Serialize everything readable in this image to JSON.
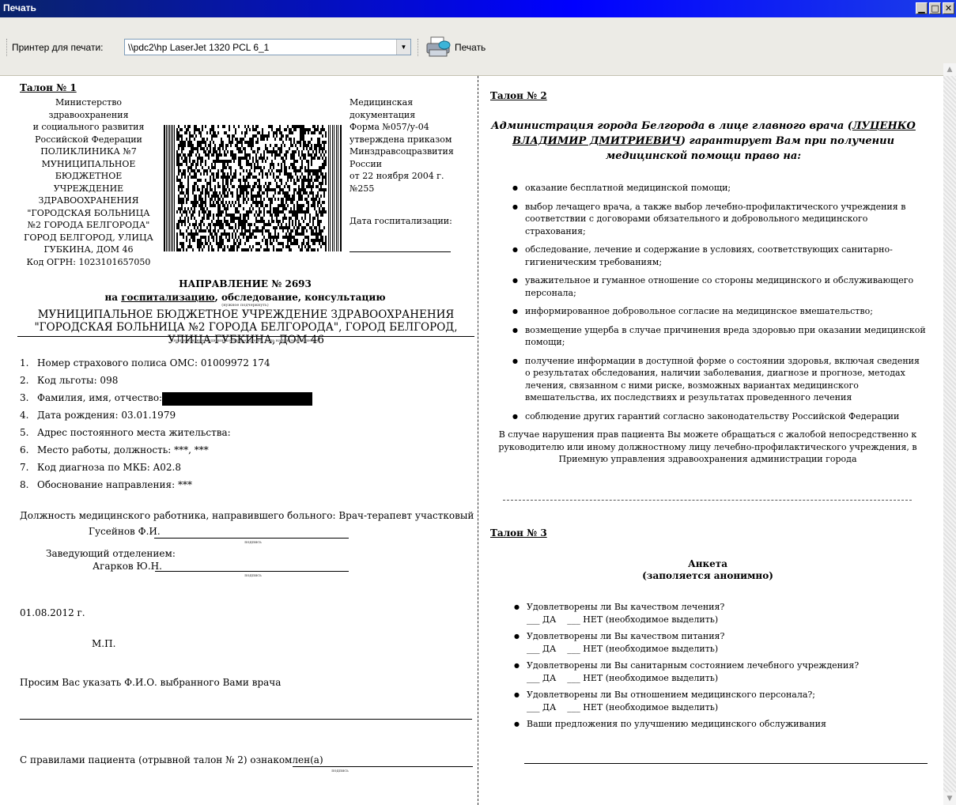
{
  "window": {
    "title": "Печать"
  },
  "toolbar": {
    "printer_label": "Принтер для печати:",
    "printer_value": "\\\\pdc2\\hp LaserJet 1320 PCL 6_1",
    "print_label": "Печать"
  },
  "talon1": {
    "heading": "Талон № 1",
    "org": [
      "Министерство",
      "здравоохранения",
      "и социального развития",
      "Российской Федерации",
      "ПОЛИКЛИНИКА №7",
      "МУНИЦИПАЛЬНОЕ",
      "БЮДЖЕТНОЕ",
      "УЧРЕЖДЕНИЕ",
      "ЗДРАВООХРАНЕНИЯ",
      "\"ГОРОДСКАЯ БОЛЬНИЦА",
      "№2 ГОРОДА БЕЛГОРОДА\"",
      "ГОРОД БЕЛГОРОД, УЛИЦА",
      "ГУБКИНА, ДОМ 46",
      "Код ОГРН: 1023101657050"
    ],
    "med_doc": [
      "Медицинская",
      "документация",
      "Форма №057/у-04",
      "утверждена приказом",
      "Минздравсоцразвития",
      "России",
      "от 22 ноября 2004 г.",
      "№255"
    ],
    "hosp_date_label": "Дата госпитализации:",
    "direction_title": "НАПРАВЛЕНИЕ № 2693",
    "direction_sub_pre": "на ",
    "direction_sub_underlined": "госпитализацию",
    "direction_sub_post": ", обследование, консультацию",
    "underline_note": "(нужное подчеркнуть)",
    "institution": "МУНИЦИПАЛЬНОЕ БЮДЖЕТНОЕ УЧРЕЖДЕНИЕ ЗДРАВООХРАНЕНИЯ \"ГОРОДСКАЯ БОЛЬНИЦА №2 ГОРОДА БЕЛГОРОДА\", ГОРОД БЕЛГОРОД, УЛИЦА ГУБКИНА, ДОМ 46",
    "institution_note": "(наименование медицинского учреждения, куда направлен пациент)",
    "items": [
      {
        "num": "1.",
        "text": "Номер страхового полиса ОМС: 01009972 174"
      },
      {
        "num": "2.",
        "text": "Код льготы: 098"
      },
      {
        "num": "3.",
        "text": "Фамилия, имя, отчество:"
      },
      {
        "num": "4.",
        "text": "Дата рождения: 03.01.1979"
      },
      {
        "num": "5.",
        "text": "Адрес постоянного места жительства:"
      },
      {
        "num": "6.",
        "text": "Место работы, должность: ***, ***"
      },
      {
        "num": "7.",
        "text": "Код диагноза по МКБ: A02.8"
      },
      {
        "num": "8.",
        "text": "Обоснование направления: ***"
      }
    ],
    "position_text": "Должность медицинского работника, направившего больного: Врач-терапевт участковый",
    "doctor_name": "Гусейнов Ф.И.",
    "signature_note": "подпись",
    "head_label": "Заведующий отделением:",
    "head_name": "Агарков Ю.Н.",
    "date": "01.08.2012 г.",
    "stamp": "М.П.",
    "choose_doctor": "Просим Вас указать Ф.И.О. выбранного Вами врача",
    "rules_ack": "С правилами пациента (отрывной талон № 2) ознакомлен(а)"
  },
  "talon2": {
    "heading": "Талон № 2",
    "intro_pre": "Администрация города Белгорода в лице главного врача (",
    "intro_name": "ЛУЦЕНКО ВЛАДИМИР ДМИТРИЕВИЧ",
    "intro_post": ") гарантирует Вам при получении медицинской помощи право на:",
    "rights": [
      "оказание бесплатной медицинской помощи;",
      "выбор лечащего врача, а также выбор лечебно-профилактического учреждения в соответствии с договорами обязательного и добровольного медицинского страхования;",
      "обследование, лечение и содержание в условиях, соответствующих санитарно-гигиеническим требованиям;",
      "уважительное и гуманное отношение со стороны медицинского и обслуживающего персонала;",
      "информированное добровольное согласие на медицинское вмешательство;",
      "возмещение ущерба в случае причинения вреда здоровью при оказании медицинской помощи;",
      "получение информации в доступной форме о состоянии здоровья, включая сведения о результатах обследования, наличии заболевания, диагнозе и прогнозе, методах лечения, связанном с ними риске, возможных вариантах медицинского вмешательства, их последствиях и результатах проведенного лечения",
      "соблюдение других гарантий согласно законодательству Российской Федерации"
    ],
    "complaint": "В случае нарушения прав пациента Вы можете обращаться с жалобой непосредственно к руководителю или иному должностному лицу лечебно-профилактического учреждения, в Приемную управления здравоохранения администрации города"
  },
  "talon3": {
    "heading": "Талон № 3",
    "title": "Анкета",
    "subtitle": "(заполяется анонимно)",
    "questions": [
      {
        "q": "Удовлетворены ли Вы качеством лечения?",
        "a": "___ ДА    ___ НЕТ (необходимое выделить)"
      },
      {
        "q": "Удовлетворены ли Вы качеством питания?",
        "a": "___ ДА    ___ НЕТ (необходимое выделить)"
      },
      {
        "q": "Удовлетворены ли Вы санитарным состоянием лечебного учреждения?",
        "a": "___ ДА    ___ НЕТ (необходимое выделить)"
      },
      {
        "q": "Удовлетворены ли Вы отношением медицинского персонала?;",
        "a": "___ ДА    ___ НЕТ (необходимое выделить)"
      },
      {
        "q": "Ваши предложения по улучшению медицинского обслуживания",
        "a": ""
      }
    ]
  },
  "icons": {
    "printer": "printer-icon",
    "minimize": "minimize-icon",
    "maximize": "maximize-icon",
    "close": "close-icon"
  }
}
